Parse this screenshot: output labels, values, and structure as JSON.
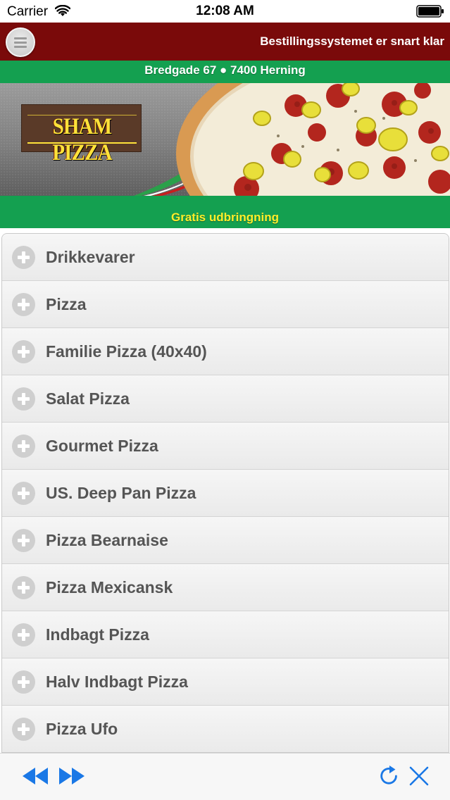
{
  "status_bar": {
    "carrier": "Carrier",
    "time": "12:08 AM",
    "wifi_icon": "wifi-icon",
    "battery_icon": "battery-icon"
  },
  "header": {
    "menu_icon": "hamburger-menu-icon",
    "title": "Bestillingssystemet er snart klar"
  },
  "address": "Bredgade 67 ● 7400 Herning",
  "banner": {
    "logo_text": "SHAM PIZZA",
    "image": "pizza-banner-image"
  },
  "tagline": "Gratis udbringning",
  "categories": [
    {
      "label": "Drikkevarer"
    },
    {
      "label": "Pizza"
    },
    {
      "label": "Familie Pizza (40x40)"
    },
    {
      "label": "Salat Pizza"
    },
    {
      "label": "Gourmet Pizza"
    },
    {
      "label": "US. Deep Pan Pizza"
    },
    {
      "label": "Pizza Bearnaise"
    },
    {
      "label": "Pizza Mexicansk"
    },
    {
      "label": "Indbagt Pizza"
    },
    {
      "label": "Halv Indbagt Pizza"
    },
    {
      "label": "Pizza Ufo"
    }
  ],
  "toolbar": {
    "back_icon": "rewind-icon",
    "forward_icon": "fast-forward-icon",
    "reload_icon": "reload-icon",
    "close_icon": "close-icon"
  },
  "colors": {
    "header_red": "#7a0a0a",
    "brand_green": "#14a050",
    "tagline_yellow": "#ffee2a",
    "toolbar_blue": "#1a78e6"
  }
}
